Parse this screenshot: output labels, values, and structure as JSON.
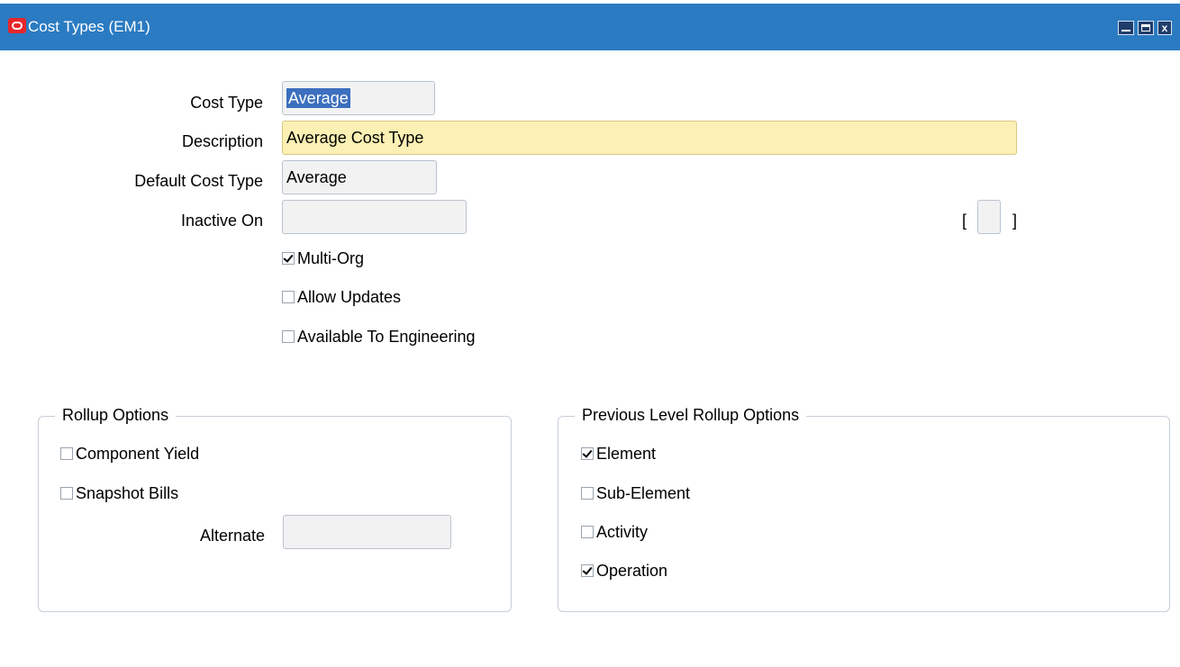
{
  "window": {
    "title": "Cost Types (EM1)"
  },
  "form": {
    "cost_type_label": "Cost Type",
    "cost_type_value": "Average",
    "description_label": "Description",
    "description_value": "Average Cost Type",
    "default_cost_type_label": "Default Cost Type",
    "default_cost_type_value": "Average",
    "inactive_on_label": "Inactive On",
    "inactive_on_value": "",
    "multi_org_label": "Multi-Org",
    "multi_org_checked": true,
    "allow_updates_label": "Allow Updates",
    "allow_updates_checked": false,
    "available_to_engineering_label": "Available To Engineering",
    "available_to_engineering_checked": false,
    "bracket_open": "[",
    "bracket_close": "]"
  },
  "rollup_options": {
    "title": "Rollup Options",
    "component_yield_label": "Component Yield",
    "component_yield_checked": false,
    "snapshot_bills_label": "Snapshot Bills",
    "snapshot_bills_checked": false,
    "alternate_label": "Alternate",
    "alternate_value": ""
  },
  "previous_level_rollup_options": {
    "title": "Previous Level Rollup Options",
    "element_label": "Element",
    "element_checked": true,
    "sub_element_label": "Sub-Element",
    "sub_element_checked": false,
    "activity_label": "Activity",
    "activity_checked": false,
    "operation_label": "Operation",
    "operation_checked": true
  },
  "colors": {
    "titlebar": "#2b7bc2",
    "required_field": "#fcf0b4",
    "selection": "#3c6fbe"
  }
}
